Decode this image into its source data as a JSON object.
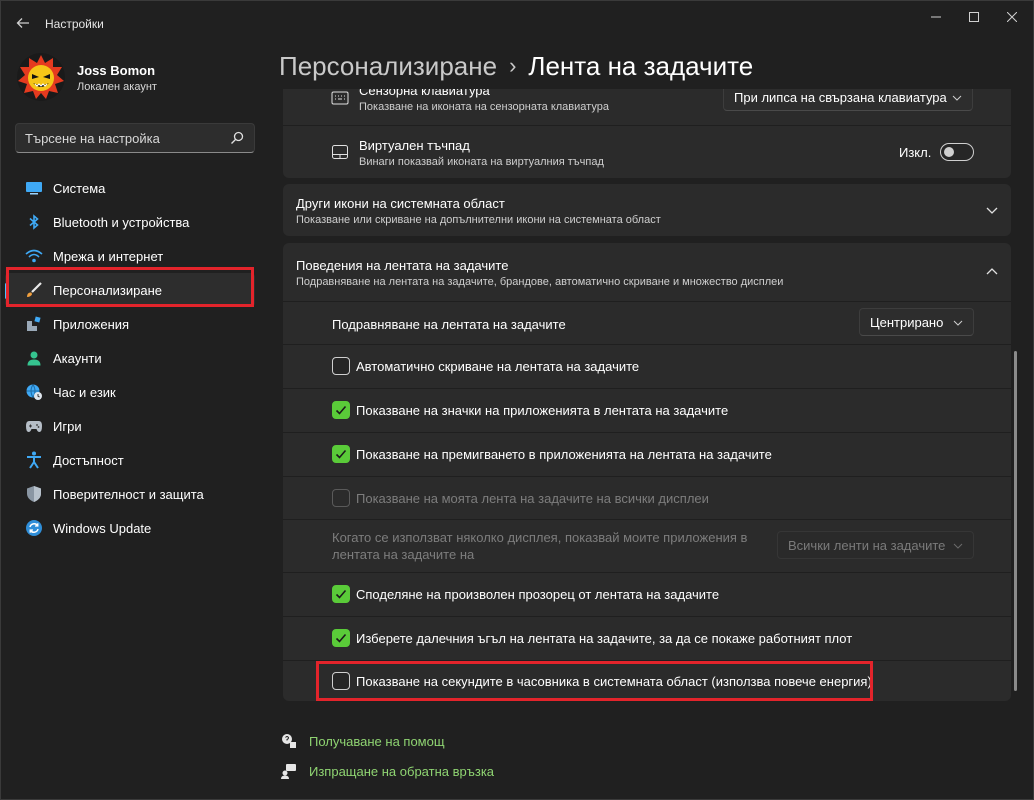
{
  "window": {
    "title": "Настройки"
  },
  "user": {
    "name": "Joss Bomon",
    "account_type": "Локален акаунт"
  },
  "search": {
    "placeholder": "Търсене на настройка"
  },
  "nav": {
    "items": [
      {
        "label": "Система",
        "icon": "monitor-icon"
      },
      {
        "label": "Bluetooth и устройства",
        "icon": "bluetooth-icon"
      },
      {
        "label": "Мрежа и интернет",
        "icon": "wifi-icon"
      },
      {
        "label": "Персонализиране",
        "icon": "brush-icon",
        "active": true
      },
      {
        "label": "Приложения",
        "icon": "apps-icon"
      },
      {
        "label": "Акаунти",
        "icon": "person-icon"
      },
      {
        "label": "Час и език",
        "icon": "globe-clock-icon"
      },
      {
        "label": "Игри",
        "icon": "gamepad-icon"
      },
      {
        "label": "Достъпност",
        "icon": "accessibility-icon"
      },
      {
        "label": "Поверителност и защита",
        "icon": "shield-icon"
      },
      {
        "label": "Windows Update",
        "icon": "update-icon"
      }
    ]
  },
  "breadcrumb": {
    "parent": "Персонализиране",
    "separator": "›",
    "current": "Лента на задачите"
  },
  "touch_keyboard": {
    "title": "Сензорна клавиатура",
    "subtitle": "Показване на иконата на сензорната клавиатура",
    "dropdown_value": "При липса на свързана клавиатура"
  },
  "touchpad": {
    "title": "Виртуален тъчпад",
    "subtitle": "Винаги показвай иконата на виртуалния тъчпад",
    "toggle_label": "Изкл.",
    "toggle_on": false
  },
  "other_icons": {
    "title": "Други икони на системната област",
    "subtitle": "Показване или скриване на допълнителни икони на системната област"
  },
  "behaviors": {
    "title": "Поведения на лентата на задачите",
    "subtitle": "Подравняване на лентата на задачите, брандове, автоматично скриване и множество дисплеи",
    "alignment_label": "Подравняване на лентата на задачите",
    "alignment_value": "Центрирано",
    "options": [
      {
        "label": "Автоматично скриване на лентата на задачите",
        "checked": false,
        "disabled": false
      },
      {
        "label": "Показване на значки на приложенията в лентата на задачите",
        "checked": true,
        "disabled": false
      },
      {
        "label": "Показване на премигването в приложенията на лентата на задачите",
        "checked": true,
        "disabled": false
      },
      {
        "label": "Показване на моята лента на задачите на всички дисплеи",
        "checked": false,
        "disabled": true
      }
    ],
    "multi_display_label": "Когато се използват няколко дисплея, показвай моите приложения в лентата на задачите на",
    "multi_display_value": "Всички ленти на задачите",
    "options2": [
      {
        "label": "Споделяне на произволен прозорец от лентата на задачите",
        "checked": true
      },
      {
        "label": "Изберете далечния ъгъл на лентата на задачите, за да се покаже работният плот",
        "checked": true
      },
      {
        "label": "Показване на секундите в часовника в системната област (използва повече енергия)",
        "checked": false
      }
    ]
  },
  "links": {
    "help": "Получаване на помощ",
    "feedback": "Изпращане на обратна връзка"
  },
  "colors": {
    "accent": "#4cc2ff",
    "checkbox_checked": "#5acb39",
    "highlight": "#e3242b",
    "link": "#8fd472"
  }
}
